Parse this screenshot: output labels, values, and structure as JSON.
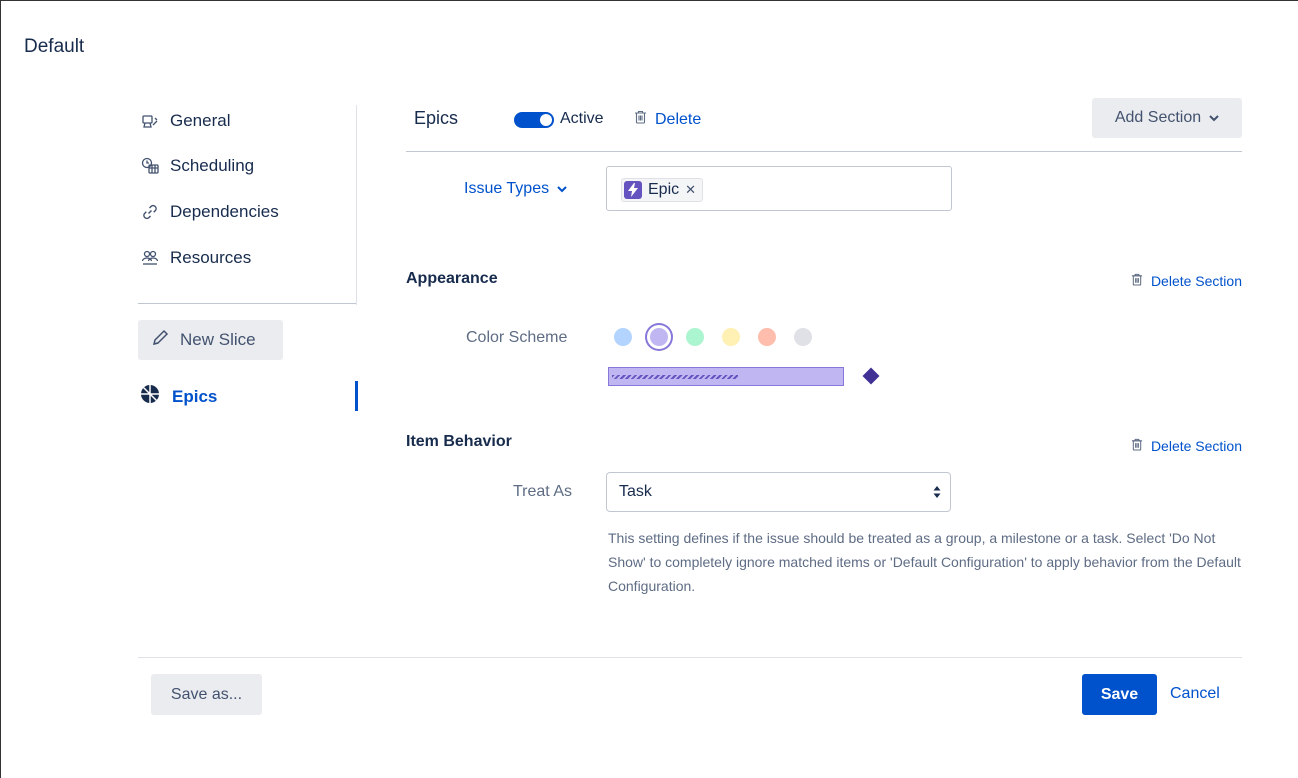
{
  "page": {
    "title": "Default"
  },
  "sidebar": {
    "items": [
      {
        "label": "General",
        "icon": "settings-sliders-icon"
      },
      {
        "label": "Scheduling",
        "icon": "calendar-clock-icon"
      },
      {
        "label": "Dependencies",
        "icon": "link-icon"
      },
      {
        "label": "Resources",
        "icon": "people-icon"
      }
    ],
    "new_slice_label": "New Slice",
    "slices": [
      {
        "label": "Epics",
        "icon": "pie-slice-icon",
        "active": true
      }
    ]
  },
  "slice": {
    "name": "Epics",
    "active_label": "Active",
    "active": true,
    "delete_label": "Delete",
    "add_section_label": "Add Section"
  },
  "issue_types": {
    "label": "Issue Types",
    "values": [
      {
        "label": "Epic",
        "icon": "lightning-icon",
        "color": "#6554c0"
      }
    ]
  },
  "appearance": {
    "title": "Appearance",
    "delete_label": "Delete Section",
    "color_scheme_label": "Color Scheme",
    "swatches": [
      {
        "color": "#b3d4ff",
        "selected": false
      },
      {
        "color": "#c0b6f2",
        "selected": true
      },
      {
        "color": "#abf5d1",
        "selected": false
      },
      {
        "color": "#fff0b3",
        "selected": false
      },
      {
        "color": "#ffbdad",
        "selected": false
      },
      {
        "color": "#dfe1e6",
        "selected": false
      }
    ],
    "bar_color": "#c0b6f2",
    "milestone_color": "#403294"
  },
  "item_behavior": {
    "title": "Item Behavior",
    "delete_label": "Delete Section",
    "treat_as_label": "Treat As",
    "treat_as_value": "Task",
    "help_text": "This setting defines if the issue should be treated as a group, a milestone or a task. Select 'Do Not Show' to completely ignore matched items or 'Default Configuration' to apply behavior from the Default Configuration."
  },
  "footer": {
    "save_as_label": "Save as...",
    "save_label": "Save",
    "cancel_label": "Cancel"
  },
  "colors": {
    "accent": "#0052cc",
    "text": "#172b4d",
    "muted": "#5e6c84"
  }
}
